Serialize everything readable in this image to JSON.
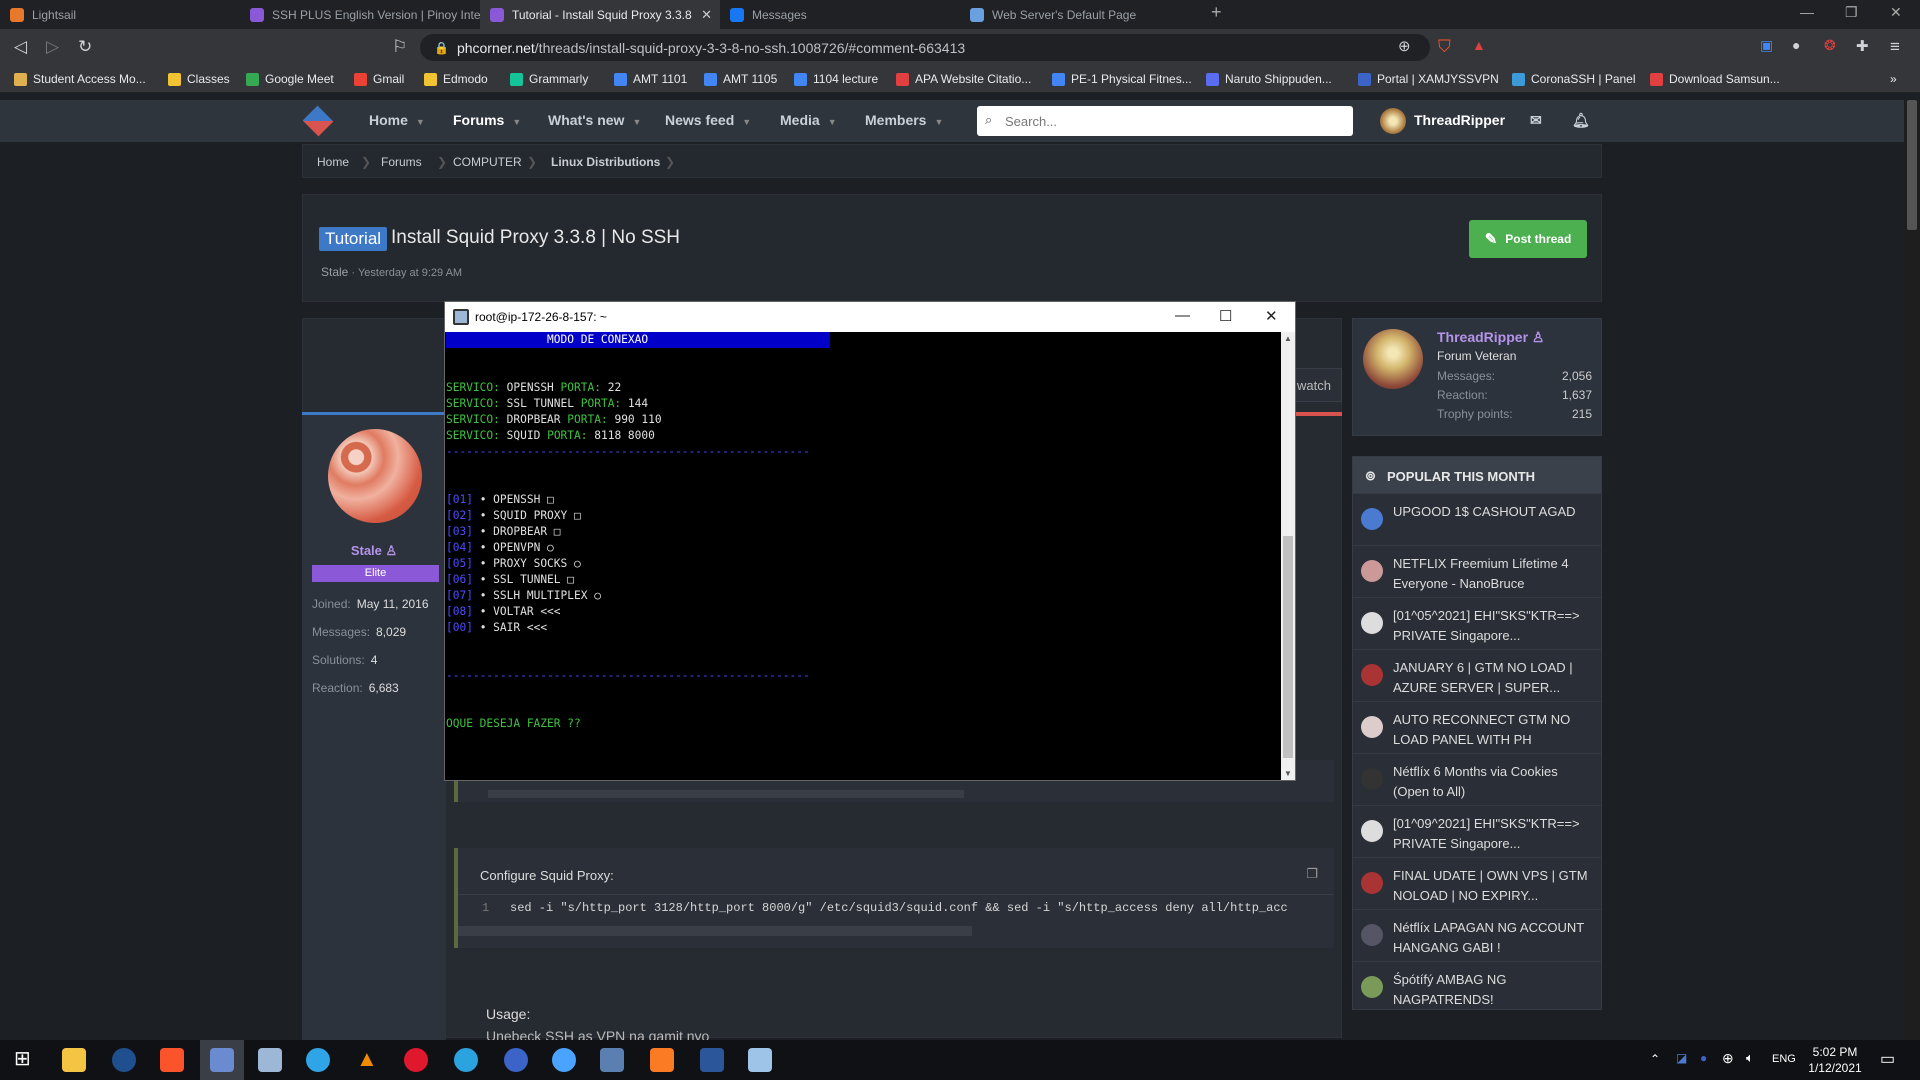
{
  "browser": {
    "tabs": [
      {
        "label": "Lightsail",
        "color": "#e8792a"
      },
      {
        "label": "SSH PLUS English Version | Pinoy Inter",
        "color": "#8b59d8"
      },
      {
        "label": "Tutorial - Install Squid Proxy 3.3.8",
        "color": "#8b59d8"
      },
      {
        "label": "Messages",
        "color": "#1877f2"
      },
      {
        "label": "Web Server's Default Page",
        "color": "#6aa0e0"
      }
    ],
    "url_host": "phcorner.net",
    "url_path": "/threads/install-squid-proxy-3-3-8-no-ssh.1008726/#comment-663413",
    "bookmarks": [
      {
        "label": "Student Access Mo...",
        "color": "#e0b050"
      },
      {
        "label": "Classes",
        "color": "#f1c232"
      },
      {
        "label": "Google Meet",
        "color": "#34a853"
      },
      {
        "label": "Gmail",
        "color": "#ea4335"
      },
      {
        "label": "Edmodo",
        "color": "#f1c232"
      },
      {
        "label": "Grammarly",
        "color": "#15c39a"
      },
      {
        "label": "AMT 1101",
        "color": "#4285f4"
      },
      {
        "label": "AMT 1105",
        "color": "#4285f4"
      },
      {
        "label": "1104 lecture",
        "color": "#4285f4"
      },
      {
        "label": "APA Website Citatio...",
        "color": "#e04040"
      },
      {
        "label": "PE-1 Physical Fitnes...",
        "color": "#4285f4"
      },
      {
        "label": "Naruto Shippuden...",
        "color": "#5a6cf0"
      },
      {
        "label": "Portal | XAMJYSSVPN",
        "color": "#3c64c8"
      },
      {
        "label": "CoronaSSH | Panel",
        "color": "#3c9ad8"
      },
      {
        "label": "Download Samsun...",
        "color": "#e04040"
      }
    ]
  },
  "sitenav": {
    "items": [
      "Home",
      "Forums",
      "What's new",
      "News feed",
      "Media",
      "Members"
    ],
    "search_placeholder": "Search...",
    "username": "ThreadRipper"
  },
  "breadcrumbs": [
    "Home",
    "Forums",
    "COMPUTER",
    "Linux Distributions"
  ],
  "thread": {
    "tag": "Tutorial",
    "title": "Install Squid Proxy 3.3.8 | No SSH",
    "author": "Stale",
    "time": "Yesterday at 9:29 AM",
    "post_button": "Post thread"
  },
  "poster": {
    "name": "Stale",
    "badge": "Elite",
    "stats": [
      {
        "label": "Joined:",
        "value": "May 11, 2016"
      },
      {
        "label": "Messages:",
        "value": "8,029"
      },
      {
        "label": "Solutions:",
        "value": "4"
      },
      {
        "label": "Reaction:",
        "value": "6,683"
      }
    ]
  },
  "post": {
    "watch_label": "watch",
    "code_label": "Configure Squid Proxy:",
    "code_line_no": "1",
    "code_line": "sed -i \"s/http_port 3128/http_port 8000/g\" /etc/squid3/squid.conf && sed -i \"s/http_access deny all/http_acc",
    "usage": "Usage:",
    "usage2": "Unebeck SSH as VPN na gamit nyo"
  },
  "sidebar": {
    "user": {
      "name": "ThreadRipper",
      "role": "Forum Veteran",
      "stats": [
        {
          "label": "Messages:",
          "value": "2,056"
        },
        {
          "label": "Reaction:",
          "value": "1,637"
        },
        {
          "label": "Trophy points:",
          "value": "215"
        }
      ]
    },
    "popular_title": "POPULAR THIS MONTH",
    "popular": [
      {
        "text": "UPGOOD 1$ CASHOUT AGAD",
        "color": "#4a7bd0"
      },
      {
        "text": "NETFLIX Freemium Lifetime 4 Everyone - NanoBruce",
        "color": "#c99"
      },
      {
        "text": "[01^05^2021] EHI\"SKS\"KTR==> PRIVATE Singapore...",
        "color": "#ddd"
      },
      {
        "text": "JANUARY 6 | GTM NO LOAD | AZURE SERVER | SUPER...",
        "color": "#a33"
      },
      {
        "text": "AUTO RECONNECT GTM NO LOAD PANEL WITH PH",
        "color": "#dcc"
      },
      {
        "text": "Nétflíx 6 Months via Cookies (Open to All)",
        "color": "#333"
      },
      {
        "text": "[01^09^2021] EHI\"SKS\"KTR==> PRIVATE Singapore...",
        "color": "#ddd"
      },
      {
        "text": "FINAL UDATE | OWN VPS | GTM NOLOAD | NO EXPIRY...",
        "color": "#a33"
      },
      {
        "text": "Nétflíx LAPAGAN NG ACCOUNT HANGANG GABI !",
        "color": "#556"
      },
      {
        "text": "Śpótífý AMBAG NG NAGPATRENDS!",
        "color": "#7a9a5a"
      }
    ]
  },
  "putty": {
    "title": "root@ip-172-26-8-157: ~",
    "header": "MODO DE CONEXAO",
    "services": [
      {
        "label": "SERVICO:",
        "name": "OPENSSH",
        "porta": "PORTA:",
        "ports": "22"
      },
      {
        "label": "SERVICO:",
        "name": "SSL TUNNEL",
        "porta": "PORTA:",
        "ports": "144"
      },
      {
        "label": "SERVICO:",
        "name": "DROPBEAR",
        "porta": "PORTA:",
        "ports": "990 110"
      },
      {
        "label": "SERVICO:",
        "name": "SQUID",
        "porta": "PORTA:",
        "ports": "8118 8000"
      }
    ],
    "menu": [
      {
        "num": "[01]",
        "label": "• OPENSSH □"
      },
      {
        "num": "[02]",
        "label": "• SQUID PROXY □"
      },
      {
        "num": "[03]",
        "label": "• DROPBEAR □"
      },
      {
        "num": "[04]",
        "label": "• OPENVPN ○"
      },
      {
        "num": "[05]",
        "label": "• PROXY SOCKS ○"
      },
      {
        "num": "[06]",
        "label": "• SSL TUNNEL □"
      },
      {
        "num": "[07]",
        "label": "• SSLH MULTIPLEX ○"
      },
      {
        "num": "[08]",
        "label": "• VOLTAR <<<"
      },
      {
        "num": "[00]",
        "label": "• SAIR <<<"
      }
    ],
    "prompt": "OQUE DESEJA FAZER ?",
    "prompt_cursor": "?"
  },
  "taskbar": {
    "icons": [
      "windows-icon",
      "file-explorer-icon",
      "cortana-icon",
      "brave-icon",
      "network-tool-icon",
      "putty-icon",
      "edge-icon",
      "vlc-icon",
      "opera-icon",
      "telegram-icon",
      "vpn-icon",
      "safari-icon",
      "network-icon",
      "xampp-icon",
      "word-icon",
      "notepad-icon"
    ],
    "lang": "ENG",
    "time": "5:02 PM",
    "date": "1/12/2021"
  }
}
